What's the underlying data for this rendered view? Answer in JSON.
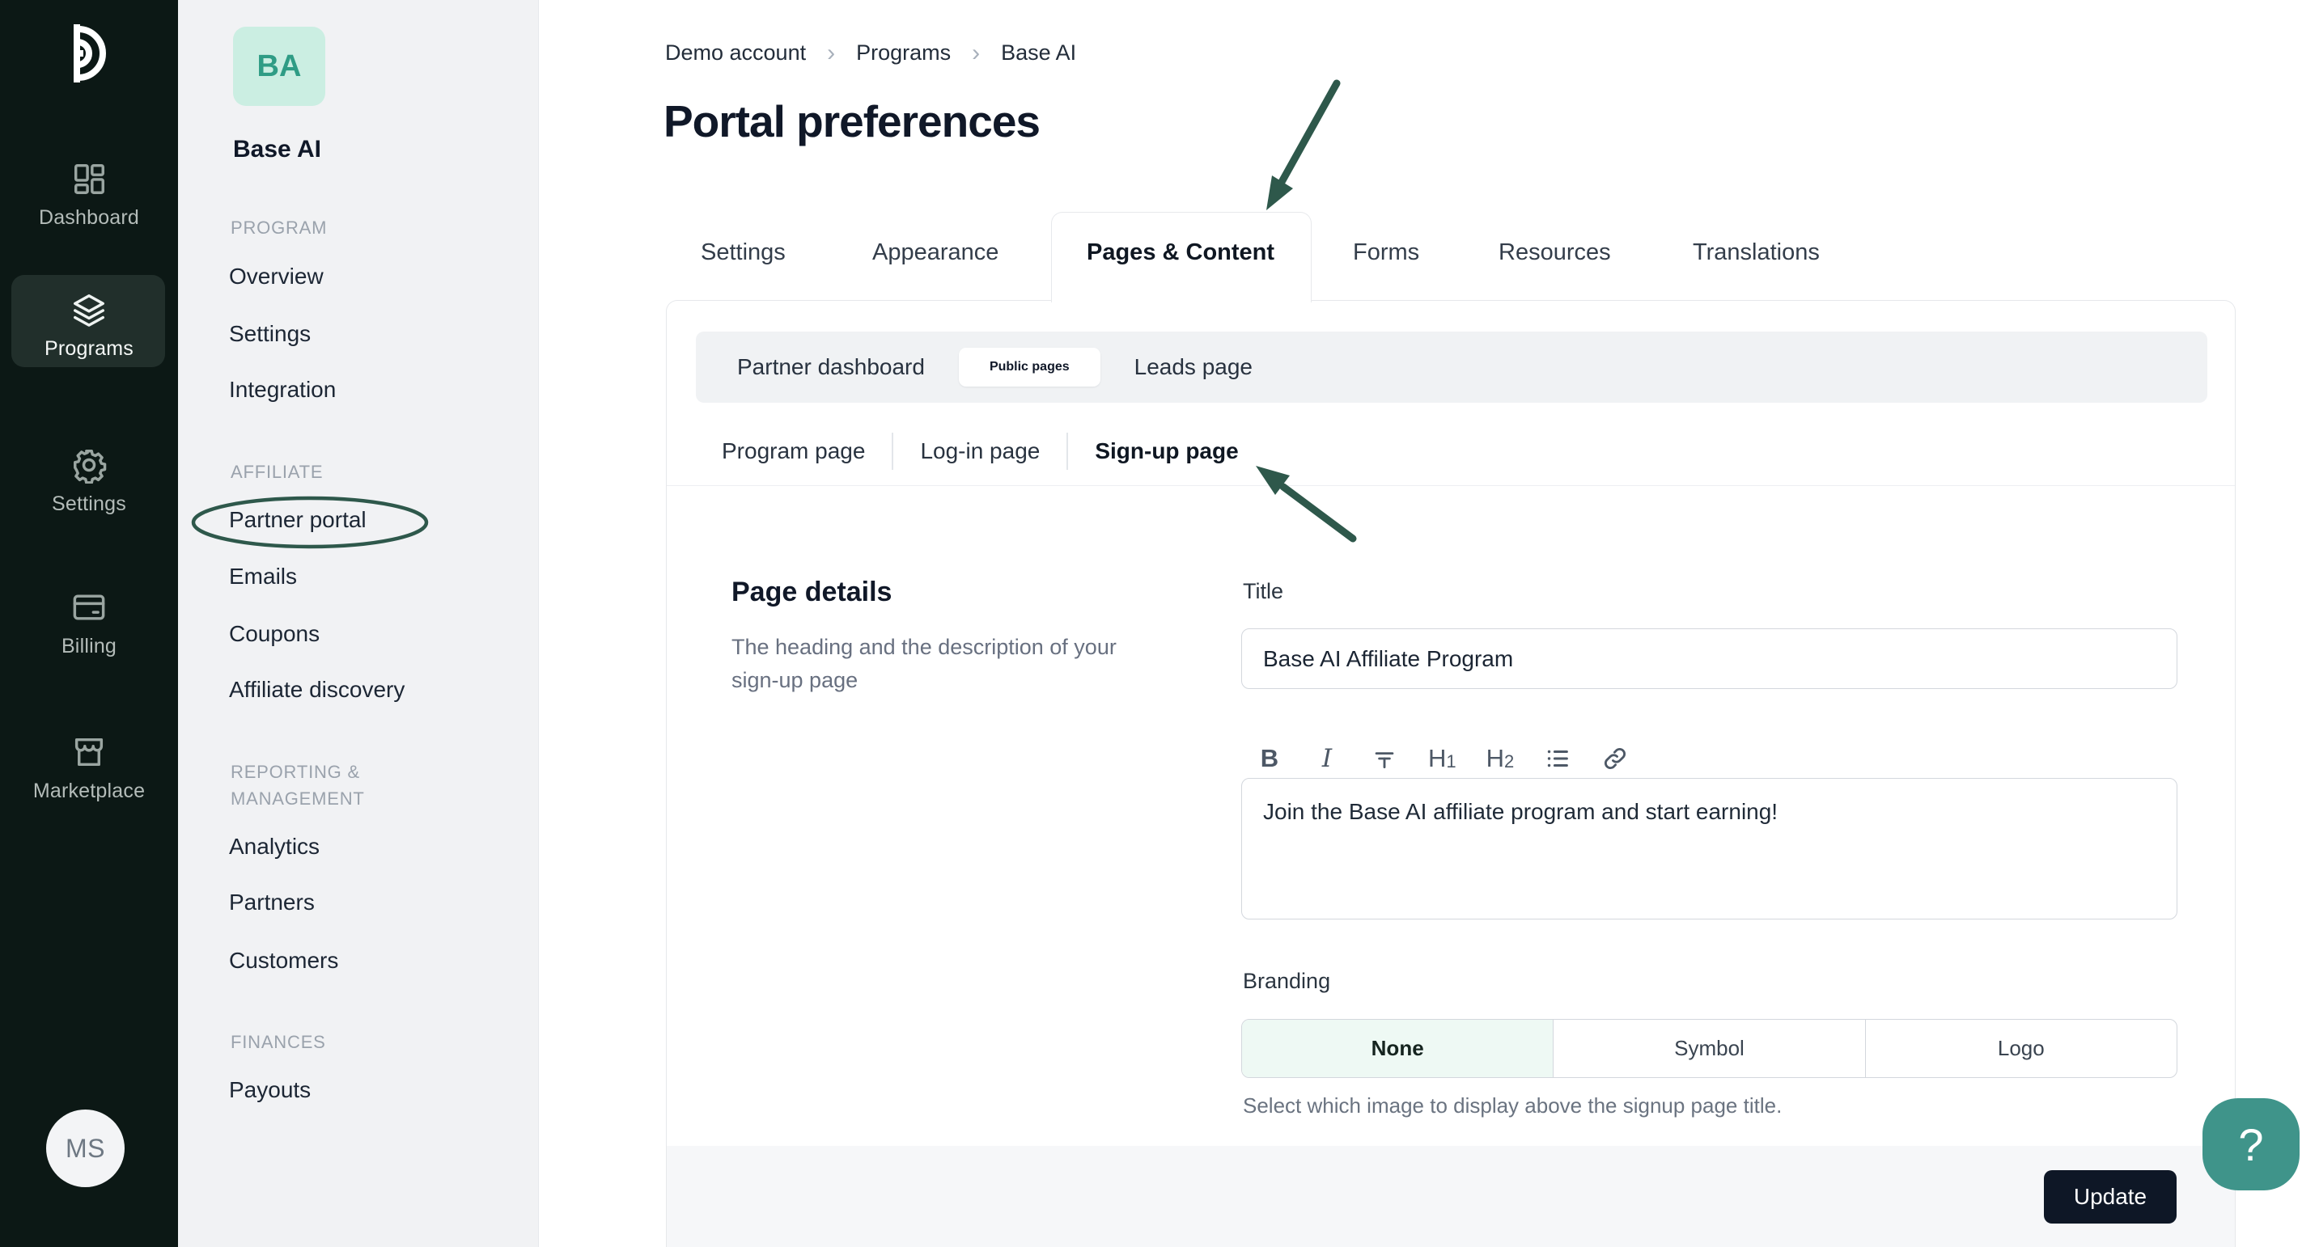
{
  "primary_nav": {
    "items": [
      {
        "label": "Dashboard",
        "icon": "dashboard-grid-icon"
      },
      {
        "label": "Programs",
        "icon": "programs-layers-icon"
      },
      {
        "label": "Settings",
        "icon": "settings-gear-icon"
      },
      {
        "label": "Billing",
        "icon": "billing-card-icon"
      },
      {
        "label": "Marketplace",
        "icon": "marketplace-store-icon"
      }
    ],
    "active_item": "Programs",
    "user_initials": "MS"
  },
  "program_nav": {
    "program_initials": "BA",
    "program_name": "Base AI",
    "headings": {
      "program": "PROGRAM",
      "affiliate": "AFFILIATE",
      "reporting_line1": "REPORTING &",
      "reporting_line2": "MANAGEMENT",
      "finances": "FINANCES"
    },
    "program_items": [
      "Overview",
      "Settings",
      "Integration"
    ],
    "affiliate_items": [
      "Partner portal",
      "Emails",
      "Coupons",
      "Affiliate discovery"
    ],
    "reporting_items": [
      "Analytics",
      "Partners",
      "Customers"
    ],
    "finances_items": [
      "Payouts"
    ],
    "circled_item": "Partner portal"
  },
  "header": {
    "breadcrumb": [
      "Demo account",
      "Programs",
      "Base AI"
    ],
    "separator": "›",
    "title": "Portal preferences"
  },
  "tabs": {
    "items": [
      "Settings",
      "Appearance",
      "Pages & Content",
      "Forms",
      "Resources",
      "Translations"
    ],
    "active": "Pages & Content"
  },
  "subtabs": {
    "items": [
      "Partner dashboard",
      "Public pages",
      "Leads page"
    ],
    "active": "Public pages"
  },
  "page_tabs": {
    "items": [
      "Program page",
      "Log-in page",
      "Sign-up page"
    ],
    "active": "Sign-up page"
  },
  "page_details": {
    "heading": "Page details",
    "description": "The heading and the description of your sign-up page",
    "title_label": "Title",
    "title_value": "Base AI Affiliate Program",
    "editor_toolbar": {
      "bold": "B",
      "italic": "I",
      "strikethrough": "strikethrough-icon",
      "h1_letter": "H",
      "h1_digit": "1",
      "h2_letter": "H",
      "h2_digit": "2",
      "list": "bullet-list-icon",
      "link": "link-icon"
    },
    "description_value": "Join the Base AI affiliate program and start earning!",
    "branding_label": "Branding",
    "branding_options": [
      "None",
      "Symbol",
      "Logo"
    ],
    "branding_selected": "None",
    "branding_help": "Select which image to display above the signup page title."
  },
  "footer": {
    "update_label": "Update"
  },
  "help": {
    "glyph": "?"
  },
  "colors": {
    "sidebar_bg": "#0c1815",
    "accent_annotation_green": "#2e584b",
    "teal_help": "#3f948a",
    "program_tile_bg": "#cbeee2",
    "program_tile_text": "#2f9c85",
    "selected_segment_bg": "#eef9f4",
    "update_button_bg": "#0e1726"
  }
}
